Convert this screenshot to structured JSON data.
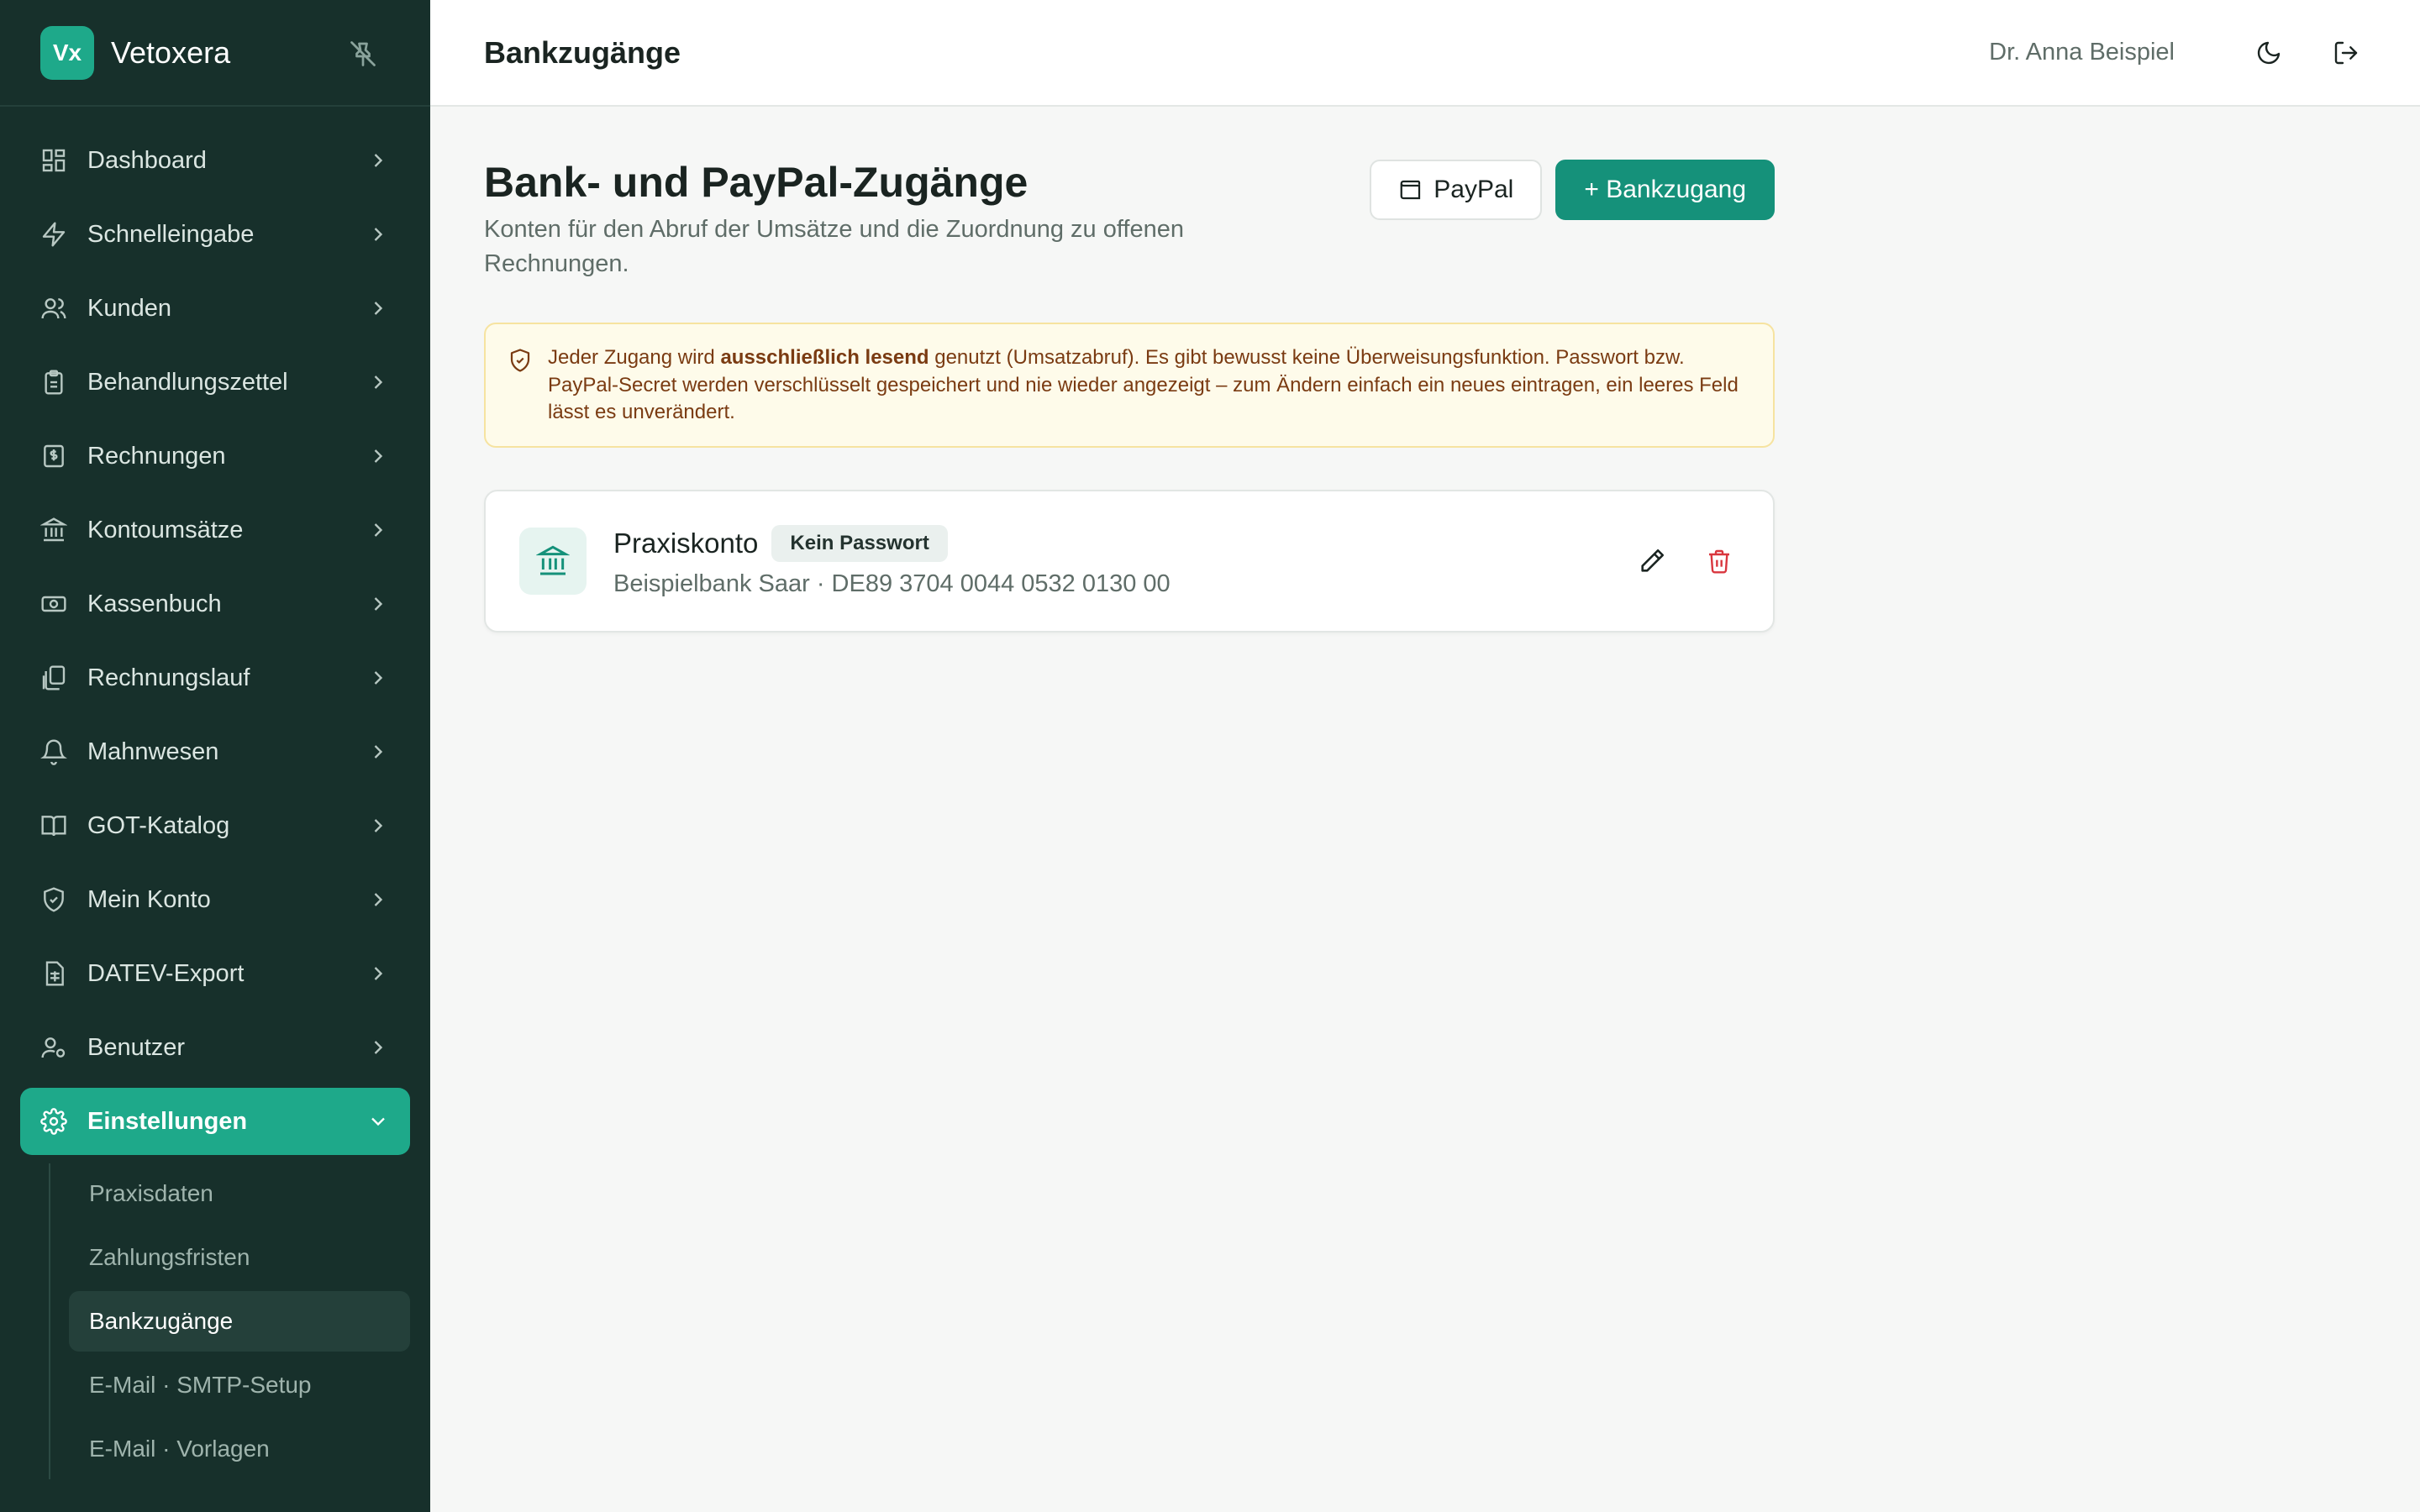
{
  "brand": {
    "logo_text": "Vx",
    "name": "Vetoxera"
  },
  "sidebar": {
    "items": [
      {
        "label": "Dashboard",
        "icon": "dashboard-icon"
      },
      {
        "label": "Schnelleingabe",
        "icon": "lightning-icon"
      },
      {
        "label": "Kunden",
        "icon": "users-icon"
      },
      {
        "label": "Behandlungszettel",
        "icon": "clipboard-icon"
      },
      {
        "label": "Rechnungen",
        "icon": "invoice-icon"
      },
      {
        "label": "Kontoumsätze",
        "icon": "bank-icon"
      },
      {
        "label": "Kassenbuch",
        "icon": "cash-icon"
      },
      {
        "label": "Rechnungslauf",
        "icon": "files-icon"
      },
      {
        "label": "Mahnwesen",
        "icon": "bell-icon"
      },
      {
        "label": "GOT-Katalog",
        "icon": "book-icon"
      },
      {
        "label": "Mein Konto",
        "icon": "shield-icon"
      },
      {
        "label": "DATEV-Export",
        "icon": "spreadsheet-icon"
      },
      {
        "label": "Benutzer",
        "icon": "user-cog-icon"
      },
      {
        "label": "Einstellungen",
        "icon": "gear-icon",
        "active": true
      }
    ],
    "subitems": [
      {
        "label": "Praxisdaten"
      },
      {
        "label": "Zahlungsfristen"
      },
      {
        "label": "Bankzugänge",
        "active": true
      },
      {
        "label": "E-Mail · SMTP-Setup"
      },
      {
        "label": "E-Mail · Vorlagen"
      }
    ]
  },
  "header": {
    "title": "Bankzugänge",
    "user": "Dr. Anna Beispiel"
  },
  "main": {
    "title": "Bank- und PayPal-Zugänge",
    "description": "Konten für den Abruf der Umsätze und die Zuordnung zu offenen Rechnungen.",
    "paypal_button": "PayPal",
    "add_button": "+ Bankzugang",
    "notice": {
      "pre": "Jeder Zugang wird ",
      "bold": "ausschließlich lesend",
      "post": " genutzt (Umsatzabruf). Es gibt bewusst keine Überweisungsfunktion. Passwort bzw. PayPal-Secret werden verschlüsselt gespeichert und nie wieder angezeigt – zum Ändern einfach ein neues eintragen, ein leeres Feld lässt es unverändert."
    },
    "accounts": [
      {
        "name": "Praxiskonto",
        "badge": "Kein Passwort",
        "details": "Beispielbank Saar · DE89 3704 0044 0532 0130 00"
      }
    ]
  },
  "colors": {
    "sidebar_bg": "#17302b",
    "accent": "#1ea98a",
    "primary_button": "#15917a",
    "delete": "#d9363e",
    "notice_bg": "#fefbea"
  }
}
